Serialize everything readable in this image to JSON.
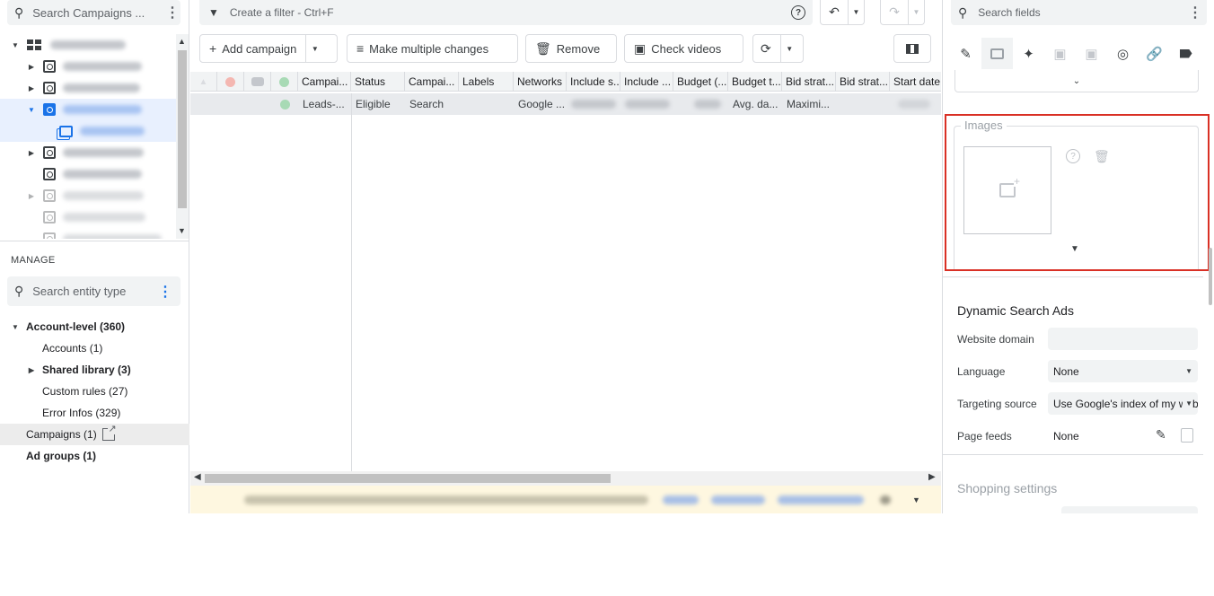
{
  "left": {
    "search_placeholder": "Search Campaigns ...",
    "manage_label": "MANAGE",
    "entity_search_placeholder": "Search entity type",
    "tree_rows": [
      {
        "type": "root",
        "selected": false
      },
      {
        "type": "campaign",
        "selected": false
      },
      {
        "type": "campaign",
        "selected": false
      },
      {
        "type": "campaign",
        "selected": true
      },
      {
        "type": "adgroup",
        "selected": true
      },
      {
        "type": "campaign",
        "selected": false
      },
      {
        "type": "campaign",
        "selected": false
      },
      {
        "type": "campaign",
        "selected": false
      },
      {
        "type": "campaign",
        "selected": false
      }
    ],
    "manage_items": [
      {
        "label": "Account-level (360)",
        "bold": true,
        "expanded": true
      },
      {
        "label": "Accounts (1)",
        "bold": false
      },
      {
        "label": "Shared library (3)",
        "bold": true,
        "expanded": false
      },
      {
        "label": "Custom rules (27)",
        "bold": false
      },
      {
        "label": "Error Infos (329)",
        "bold": false
      },
      {
        "label": "Campaigns (1)",
        "bold": false,
        "selected": true
      },
      {
        "label": "Ad groups (1)",
        "bold": true
      }
    ]
  },
  "toolbar": {
    "filter_placeholder": "Create a filter - Ctrl+F",
    "add_campaign": "Add campaign",
    "make_multiple_changes": "Make multiple changes",
    "remove": "Remove",
    "check_videos": "Check videos"
  },
  "table": {
    "headers": [
      "Campai...",
      "Status",
      "Campai...",
      "Labels",
      "Networks",
      "Include s...",
      "Include ...",
      "Budget (...",
      "Budget t...",
      "Bid strat...",
      "Bid strat...",
      "Start date"
    ],
    "row": {
      "campaign": "Leads-...",
      "status": "Eligible",
      "campaign_type": "Search",
      "labels": "",
      "networks": "Google ...",
      "budget_type": "Avg. da...",
      "bid_strategy": "Maximi..."
    }
  },
  "right": {
    "search_placeholder": "Search fields",
    "images_label": "Images",
    "dsa_title": "Dynamic Search Ads",
    "website_domain_label": "Website domain",
    "website_domain_value": "",
    "language_label": "Language",
    "language_value": "None",
    "targeting_source_label": "Targeting source",
    "targeting_source_value": "Use Google's index of my website",
    "page_feeds_label": "Page feeds",
    "page_feeds_value": "None",
    "shopping_title": "Shopping settings"
  },
  "colors": {
    "highlight": "#d93025",
    "accent": "#1a73e8",
    "status_green": "#34a853"
  }
}
